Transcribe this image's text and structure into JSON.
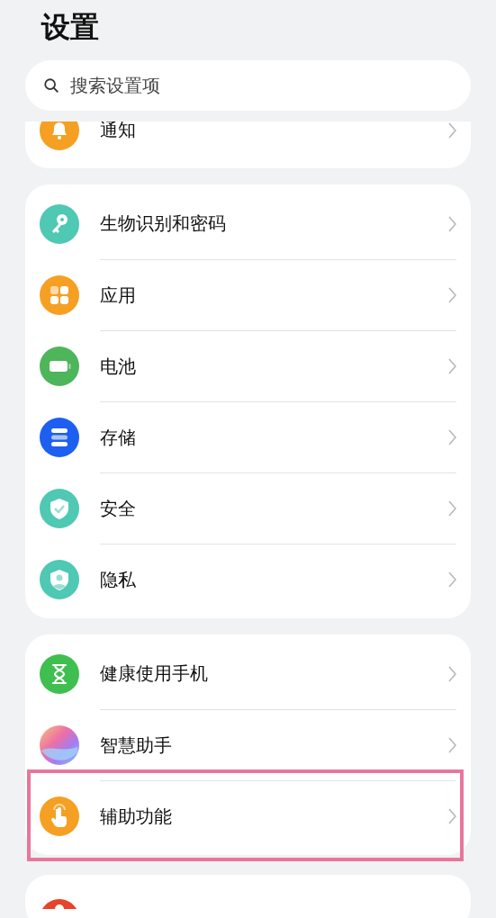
{
  "title": "设置",
  "search": {
    "placeholder": "搜索设置项"
  },
  "groups": [
    {
      "clipped_top": true,
      "items": [
        {
          "label": "通知",
          "highlighted": false
        }
      ]
    },
    {
      "clipped_top": false,
      "items": [
        {
          "label": "生物识别和密码",
          "highlighted": false
        },
        {
          "label": "应用",
          "highlighted": false
        },
        {
          "label": "电池",
          "highlighted": false
        },
        {
          "label": "存储",
          "highlighted": false
        },
        {
          "label": "安全",
          "highlighted": false
        },
        {
          "label": "隐私",
          "highlighted": false
        }
      ]
    },
    {
      "clipped_top": false,
      "items": [
        {
          "label": "健康使用手机",
          "highlighted": false
        },
        {
          "label": "智慧助手",
          "highlighted": false
        },
        {
          "label": "辅助功能",
          "highlighted": true
        }
      ]
    }
  ]
}
